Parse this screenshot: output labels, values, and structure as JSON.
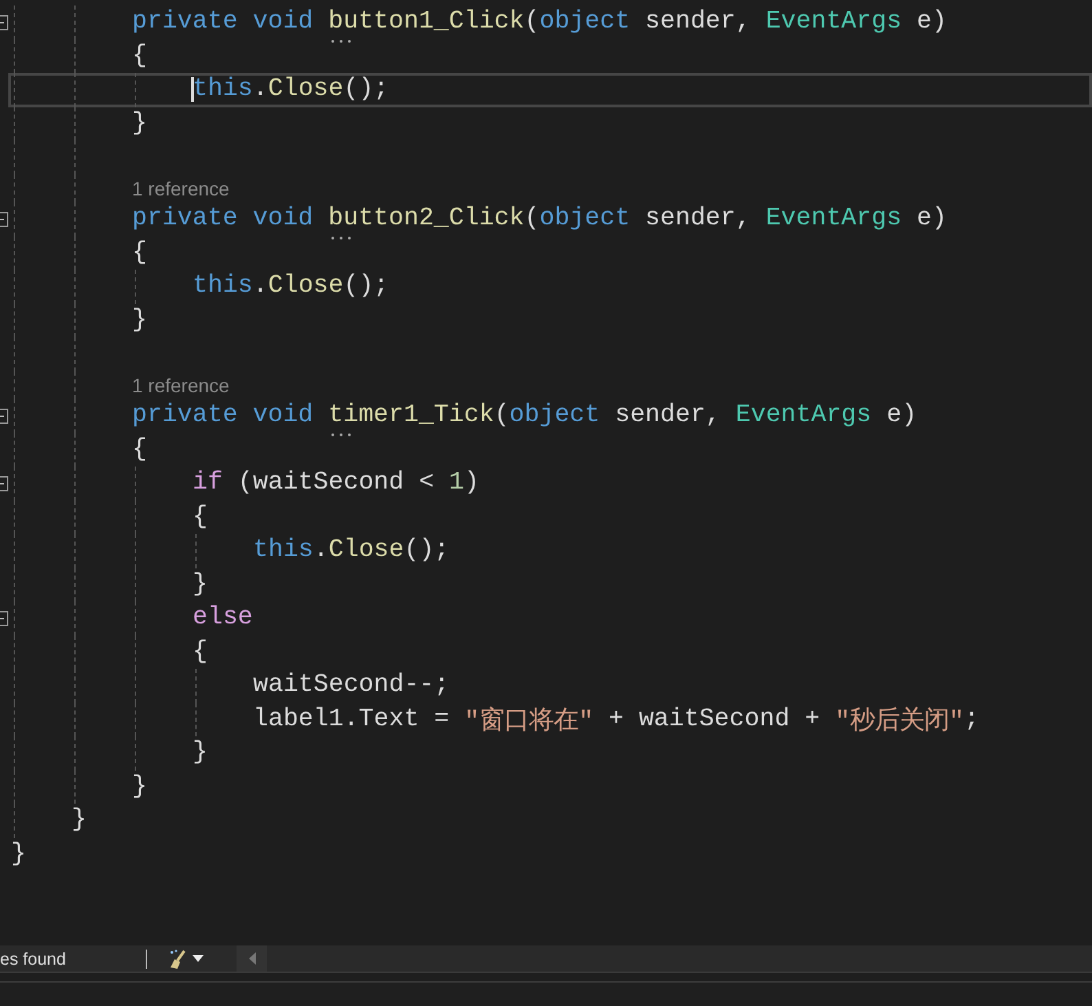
{
  "editor": {
    "lines": [
      {
        "kind": "group",
        "children": [
          {
            "kind": "group",
            "children": [
              {
                "kind": "code",
                "fold": true,
                "current": false,
                "tokens": [
                  {
                    "kind": "keyword",
                    "text": "private "
                  },
                  {
                    "kind": "keyword",
                    "text": "void "
                  },
                  {
                    "kind": "decl",
                    "text": "button1_Click"
                  },
                  {
                    "kind": "plain",
                    "text": "("
                  },
                  {
                    "kind": "keyword",
                    "text": "object"
                  },
                  {
                    "kind": "plain",
                    "text": " sender, "
                  },
                  {
                    "kind": "type",
                    "text": "EventArgs"
                  },
                  {
                    "kind": "plain",
                    "text": " e)"
                  }
                ]
              },
              {
                "kind": "code",
                "fold": false,
                "current": false,
                "tokens": [
                  {
                    "kind": "plain",
                    "text": "{"
                  }
                ],
                "children": [
                  {
                    "kind": "code",
                    "fold": false,
                    "current": true,
                    "tokens": [
                      {
                        "kind": "keyword",
                        "text": "this"
                      },
                      {
                        "kind": "plain",
                        "text": "."
                      },
                      {
                        "kind": "method",
                        "text": "Close"
                      },
                      {
                        "kind": "plain",
                        "text": "();"
                      }
                    ]
                  }
                ]
              },
              {
                "kind": "code",
                "fold": false,
                "current": false,
                "tokens": [
                  {
                    "kind": "plain",
                    "text": "}"
                  }
                ]
              },
              {
                "kind": "blank",
                "fold": false,
                "current": false
              },
              {
                "kind": "codelens",
                "fold": false,
                "current": false,
                "tokens": [
                  {
                    "kind": "lens",
                    "text": "1 reference"
                  }
                ]
              },
              {
                "kind": "code",
                "fold": true,
                "current": false,
                "tokens": [
                  {
                    "kind": "keyword",
                    "text": "private "
                  },
                  {
                    "kind": "keyword",
                    "text": "void "
                  },
                  {
                    "kind": "decl",
                    "text": "button2_Click"
                  },
                  {
                    "kind": "plain",
                    "text": "("
                  },
                  {
                    "kind": "keyword",
                    "text": "object"
                  },
                  {
                    "kind": "plain",
                    "text": " sender, "
                  },
                  {
                    "kind": "type",
                    "text": "EventArgs"
                  },
                  {
                    "kind": "plain",
                    "text": " e)"
                  }
                ]
              },
              {
                "kind": "code",
                "fold": false,
                "current": false,
                "tokens": [
                  {
                    "kind": "plain",
                    "text": "{"
                  }
                ],
                "children": [
                  {
                    "kind": "code",
                    "fold": false,
                    "current": false,
                    "tokens": [
                      {
                        "kind": "keyword",
                        "text": "this"
                      },
                      {
                        "kind": "plain",
                        "text": "."
                      },
                      {
                        "kind": "method",
                        "text": "Close"
                      },
                      {
                        "kind": "plain",
                        "text": "();"
                      }
                    ]
                  }
                ]
              },
              {
                "kind": "code",
                "fold": false,
                "current": false,
                "tokens": [
                  {
                    "kind": "plain",
                    "text": "}"
                  }
                ]
              },
              {
                "kind": "blank",
                "fold": false,
                "current": false
              },
              {
                "kind": "codelens",
                "fold": false,
                "current": false,
                "tokens": [
                  {
                    "kind": "lens",
                    "text": "1 reference"
                  }
                ]
              },
              {
                "kind": "code",
                "fold": true,
                "current": false,
                "tokens": [
                  {
                    "kind": "keyword",
                    "text": "private "
                  },
                  {
                    "kind": "keyword",
                    "text": "void "
                  },
                  {
                    "kind": "decl",
                    "text": "timer1_Tick"
                  },
                  {
                    "kind": "plain",
                    "text": "("
                  },
                  {
                    "kind": "keyword",
                    "text": "object"
                  },
                  {
                    "kind": "plain",
                    "text": " sender, "
                  },
                  {
                    "kind": "type",
                    "text": "EventArgs"
                  },
                  {
                    "kind": "plain",
                    "text": " e)"
                  }
                ]
              },
              {
                "kind": "code",
                "fold": false,
                "current": false,
                "tokens": [
                  {
                    "kind": "plain",
                    "text": "{"
                  }
                ],
                "children": [
                  {
                    "kind": "code",
                    "fold": true,
                    "current": false,
                    "tokens": [
                      {
                        "kind": "control",
                        "text": "if"
                      },
                      {
                        "kind": "plain",
                        "text": " (waitSecond < "
                      },
                      {
                        "kind": "number",
                        "text": "1"
                      },
                      {
                        "kind": "plain",
                        "text": ")"
                      }
                    ]
                  },
                  {
                    "kind": "code",
                    "fold": false,
                    "current": false,
                    "tokens": [
                      {
                        "kind": "plain",
                        "text": "{"
                      }
                    ],
                    "children": [
                      {
                        "kind": "code",
                        "fold": false,
                        "current": false,
                        "tokens": [
                          {
                            "kind": "keyword",
                            "text": "this"
                          },
                          {
                            "kind": "plain",
                            "text": "."
                          },
                          {
                            "kind": "method",
                            "text": "Close"
                          },
                          {
                            "kind": "plain",
                            "text": "();"
                          }
                        ]
                      }
                    ]
                  },
                  {
                    "kind": "code",
                    "fold": false,
                    "current": false,
                    "tokens": [
                      {
                        "kind": "plain",
                        "text": "}"
                      }
                    ]
                  },
                  {
                    "kind": "code",
                    "fold": true,
                    "current": false,
                    "tokens": [
                      {
                        "kind": "control",
                        "text": "else"
                      }
                    ]
                  },
                  {
                    "kind": "code",
                    "fold": false,
                    "current": false,
                    "tokens": [
                      {
                        "kind": "plain",
                        "text": "{"
                      }
                    ],
                    "children": [
                      {
                        "kind": "code",
                        "fold": false,
                        "current": false,
                        "tokens": [
                          {
                            "kind": "plain",
                            "text": "waitSecond--;"
                          }
                        ]
                      },
                      {
                        "kind": "code",
                        "fold": false,
                        "current": false,
                        "tokens": [
                          {
                            "kind": "plain",
                            "text": "label1.Text = "
                          },
                          {
                            "kind": "string",
                            "text": "\"窗口将在\""
                          },
                          {
                            "kind": "plain",
                            "text": " + waitSecond + "
                          },
                          {
                            "kind": "string",
                            "text": "\"秒后关闭\""
                          },
                          {
                            "kind": "plain",
                            "text": ";"
                          }
                        ]
                      }
                    ]
                  },
                  {
                    "kind": "code",
                    "fold": false,
                    "current": false,
                    "tokens": [
                      {
                        "kind": "plain",
                        "text": "}"
                      }
                    ]
                  }
                ]
              },
              {
                "kind": "code",
                "fold": false,
                "current": false,
                "tokens": [
                  {
                    "kind": "plain",
                    "text": "}"
                  }
                ]
              }
            ]
          },
          {
            "kind": "code",
            "fold": false,
            "current": false,
            "tokens": [
              {
                "kind": "plain",
                "text": "}"
              }
            ]
          }
        ]
      },
      {
        "kind": "code",
        "fold": false,
        "current": false,
        "tokens": [
          {
            "kind": "plain",
            "text": "}"
          }
        ]
      }
    ]
  },
  "status_bar": {
    "text": "es found"
  }
}
